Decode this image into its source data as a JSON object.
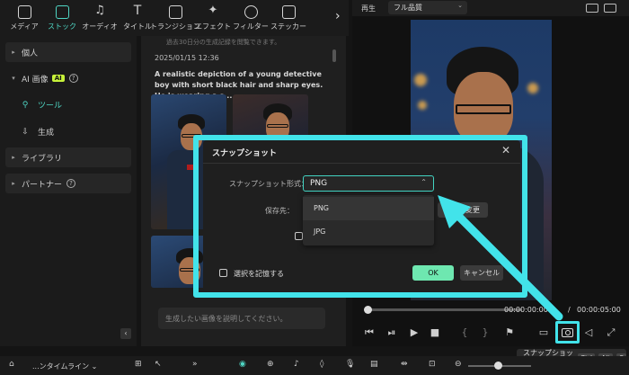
{
  "toolbar": {
    "items": [
      {
        "label": "メディア",
        "icon": "media-icon"
      },
      {
        "label": "ストック",
        "icon": "stock-icon",
        "active": true
      },
      {
        "label": "オーディオ",
        "icon": "music-note-icon"
      },
      {
        "label": "タイトル",
        "icon": "title-T-icon"
      },
      {
        "label": "トランジション",
        "icon": "transition-icon"
      },
      {
        "label": "エフェクト",
        "icon": "effect-sparkle-icon"
      },
      {
        "label": "フィルター",
        "icon": "filter-icon"
      },
      {
        "label": "ステッカー",
        "icon": "sticker-icon"
      }
    ],
    "more_icon": "chevron-right-icon"
  },
  "sidebar": {
    "personal": "個人",
    "ai_image": "AI 画像",
    "ai_badge": "AI",
    "tools": "ツール",
    "generate": "生成",
    "library": "ライブラリ",
    "partner": "パートナー"
  },
  "middle": {
    "note": "過去30日分の生成記録を閲覧できます。",
    "date": "2025/01/15 12:36",
    "prompt": "A realistic depiction of a young detective boy with short black hair and sharp eyes. He is wearing a s...",
    "prompt_placeholder": "生成したい画像を説明してください。"
  },
  "player": {
    "label": "再生",
    "quality": "フル品質",
    "current_time": "00:00:00:00",
    "separator": "/",
    "total_time": "00:00:05:00"
  },
  "tooltip": {
    "label": "スナップショット",
    "keys": [
      "Ctrl",
      "Alt",
      "S"
    ]
  },
  "bottombar": {
    "timeline_label": "...ンタイムライン",
    "timeline_chevron": "⌄"
  },
  "dialog": {
    "title": "スナップショット",
    "close": "✕",
    "format_label": "スナップショット形式：",
    "format_value": "PNG",
    "save_label": "保存先：",
    "change_button": "変更",
    "options": [
      "PNG",
      "JPG"
    ],
    "remember_label": "選択を記憶する",
    "ok": "OK",
    "cancel": "キャンセル"
  },
  "colors": {
    "accent": "#4fd6c4",
    "highlight": "#42e3ea",
    "ok_button": "#6ee7b0",
    "ai_badge": "#c7f23a"
  }
}
